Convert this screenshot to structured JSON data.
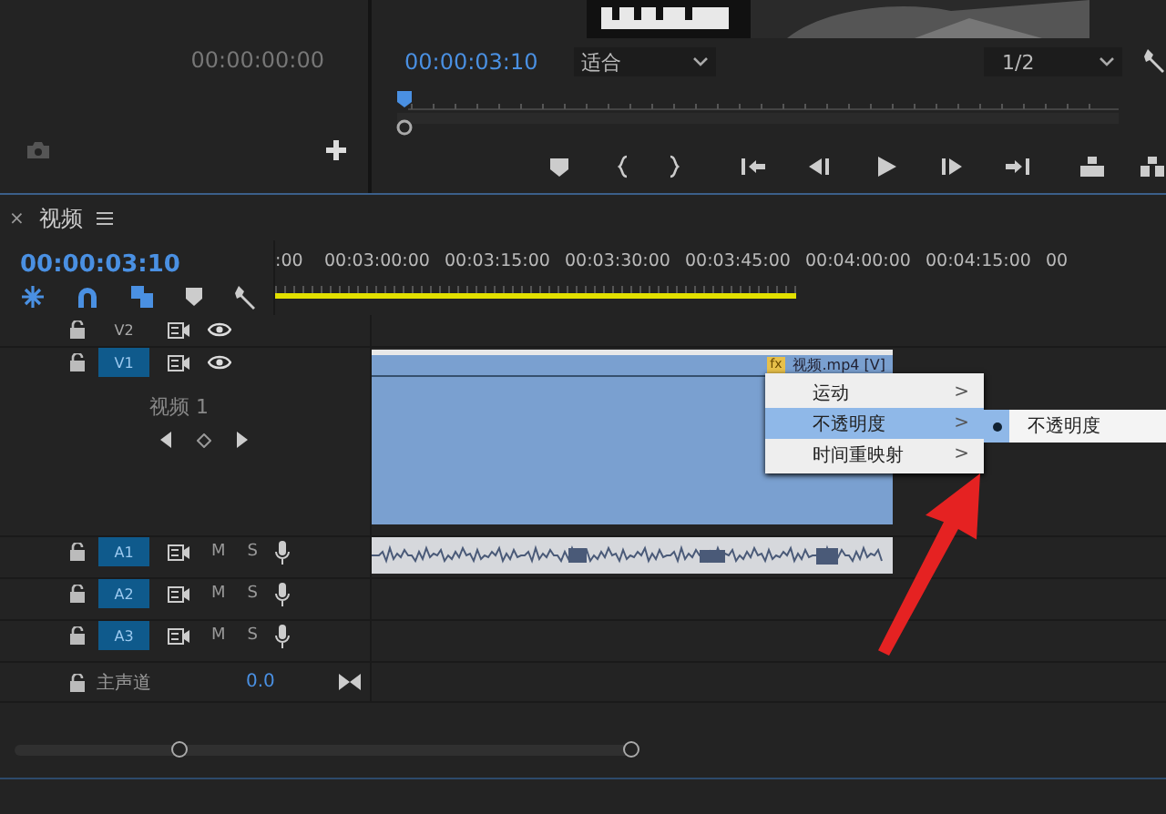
{
  "source_monitor": {
    "timecode": "00:00:00:00"
  },
  "program_monitor": {
    "timecode": "00:00:03:10",
    "fit": "适合",
    "resolution": "1/2"
  },
  "timeline": {
    "close": "×",
    "title": "视频",
    "timecode": "00:00:03:10",
    "ruler": [
      ":00",
      "00:03:00:00",
      "00:03:15:00",
      "00:03:30:00",
      "00:03:45:00",
      "00:04:00:00",
      "00:04:15:00",
      "00"
    ],
    "video_tracks": [
      {
        "label": "V2",
        "targeted": false
      },
      {
        "label": "V1",
        "targeted": true,
        "name": "视频 1"
      }
    ],
    "audio_tracks": [
      {
        "label": "A1",
        "targeted": true,
        "m": "M",
        "s": "S"
      },
      {
        "label": "A2",
        "targeted": true,
        "m": "M",
        "s": "S"
      },
      {
        "label": "A3",
        "targeted": true,
        "m": "M",
        "s": "S"
      }
    ],
    "master": {
      "label": "主声道",
      "value": "0.0"
    },
    "clip": {
      "badge": "fx",
      "title": "视频.mp4 [V]"
    },
    "context_menu": {
      "items": [
        {
          "label": "运动",
          "selected": false,
          "arrow": ">"
        },
        {
          "label": "不透明度",
          "selected": true,
          "arrow": ">"
        },
        {
          "label": "时间重映射",
          "selected": false,
          "arrow": ">"
        }
      ],
      "submenu": [
        {
          "label": "不透明度",
          "checked": true
        }
      ]
    }
  }
}
